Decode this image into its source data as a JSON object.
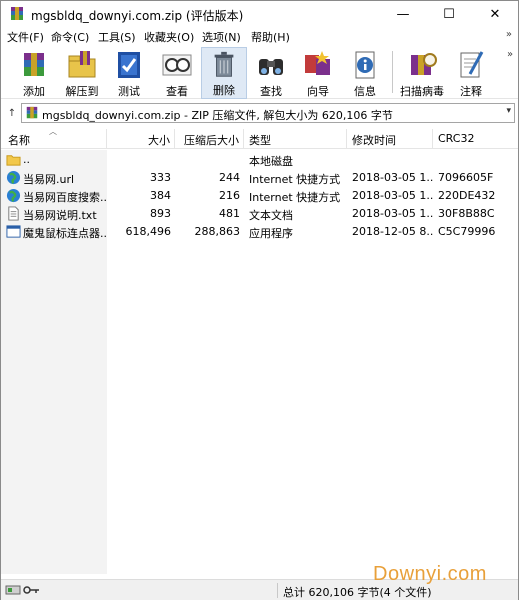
{
  "window": {
    "title": "mgsbldq_downyi.com.zip (评估版本)",
    "min_glyph": "—",
    "max_glyph": "☐",
    "close_glyph": "✕"
  },
  "menu": [
    {
      "label": "文件(F)"
    },
    {
      "label": "命令(C)"
    },
    {
      "label": "工具(S)"
    },
    {
      "label": "收藏夹(O)"
    },
    {
      "label": "选项(N)"
    },
    {
      "label": "帮助(H)"
    }
  ],
  "menu_overflow": "»",
  "toolbar": [
    {
      "label": "添加",
      "icon": "add-archive-icon"
    },
    {
      "label": "解压到",
      "icon": "extract-to-icon"
    },
    {
      "label": "测试",
      "icon": "test-icon"
    },
    {
      "label": "查看",
      "icon": "view-icon"
    },
    {
      "label": "删除",
      "icon": "delete-icon"
    },
    {
      "label": "查找",
      "icon": "find-icon"
    },
    {
      "label": "向导",
      "icon": "wizard-icon"
    },
    {
      "label": "信息",
      "icon": "info-icon"
    },
    {
      "label": "扫描病毒",
      "icon": "virus-scan-icon"
    },
    {
      "label": "注释",
      "icon": "comment-icon"
    }
  ],
  "toolbar_overflow": "»",
  "address": {
    "text": "mgsbldq_downyi.com.zip - ZIP 压缩文件, 解包大小为 620,106 字节",
    "up_glyph": "↑",
    "drop_glyph": "▾"
  },
  "columns": [
    {
      "label": "名称"
    },
    {
      "label": "大小"
    },
    {
      "label": "压缩后大小"
    },
    {
      "label": "类型"
    },
    {
      "label": "修改时间"
    },
    {
      "label": "CRC32"
    }
  ],
  "sort_glyph": "︿",
  "rows": [
    {
      "name": "..",
      "size": "",
      "packed": "",
      "type": "本地磁盘",
      "modified": "",
      "crc": "",
      "icon": "folder-icon"
    },
    {
      "name": "当易网.url",
      "size": "333",
      "packed": "244",
      "type": "Internet 快捷方式",
      "modified": "2018-03-05 1...",
      "crc": "7096605F",
      "icon": "internet-shortcut-icon"
    },
    {
      "name": "当易网百度搜索....",
      "size": "384",
      "packed": "216",
      "type": "Internet 快捷方式",
      "modified": "2018-03-05 1...",
      "crc": "220DE432",
      "icon": "internet-shortcut-icon"
    },
    {
      "name": "当易网说明.txt",
      "size": "893",
      "packed": "481",
      "type": "文本文档",
      "modified": "2018-03-05 1...",
      "crc": "30F8B88C",
      "icon": "text-file-icon"
    },
    {
      "name": "魔鬼鼠标连点器....",
      "size": "618,496",
      "packed": "288,863",
      "type": "应用程序",
      "modified": "2018-12-05 8...",
      "crc": "C5C79996",
      "icon": "application-icon"
    }
  ],
  "status": {
    "text": "总计 620,106 字节(4 个文件)"
  },
  "watermark": "Downyi.com"
}
